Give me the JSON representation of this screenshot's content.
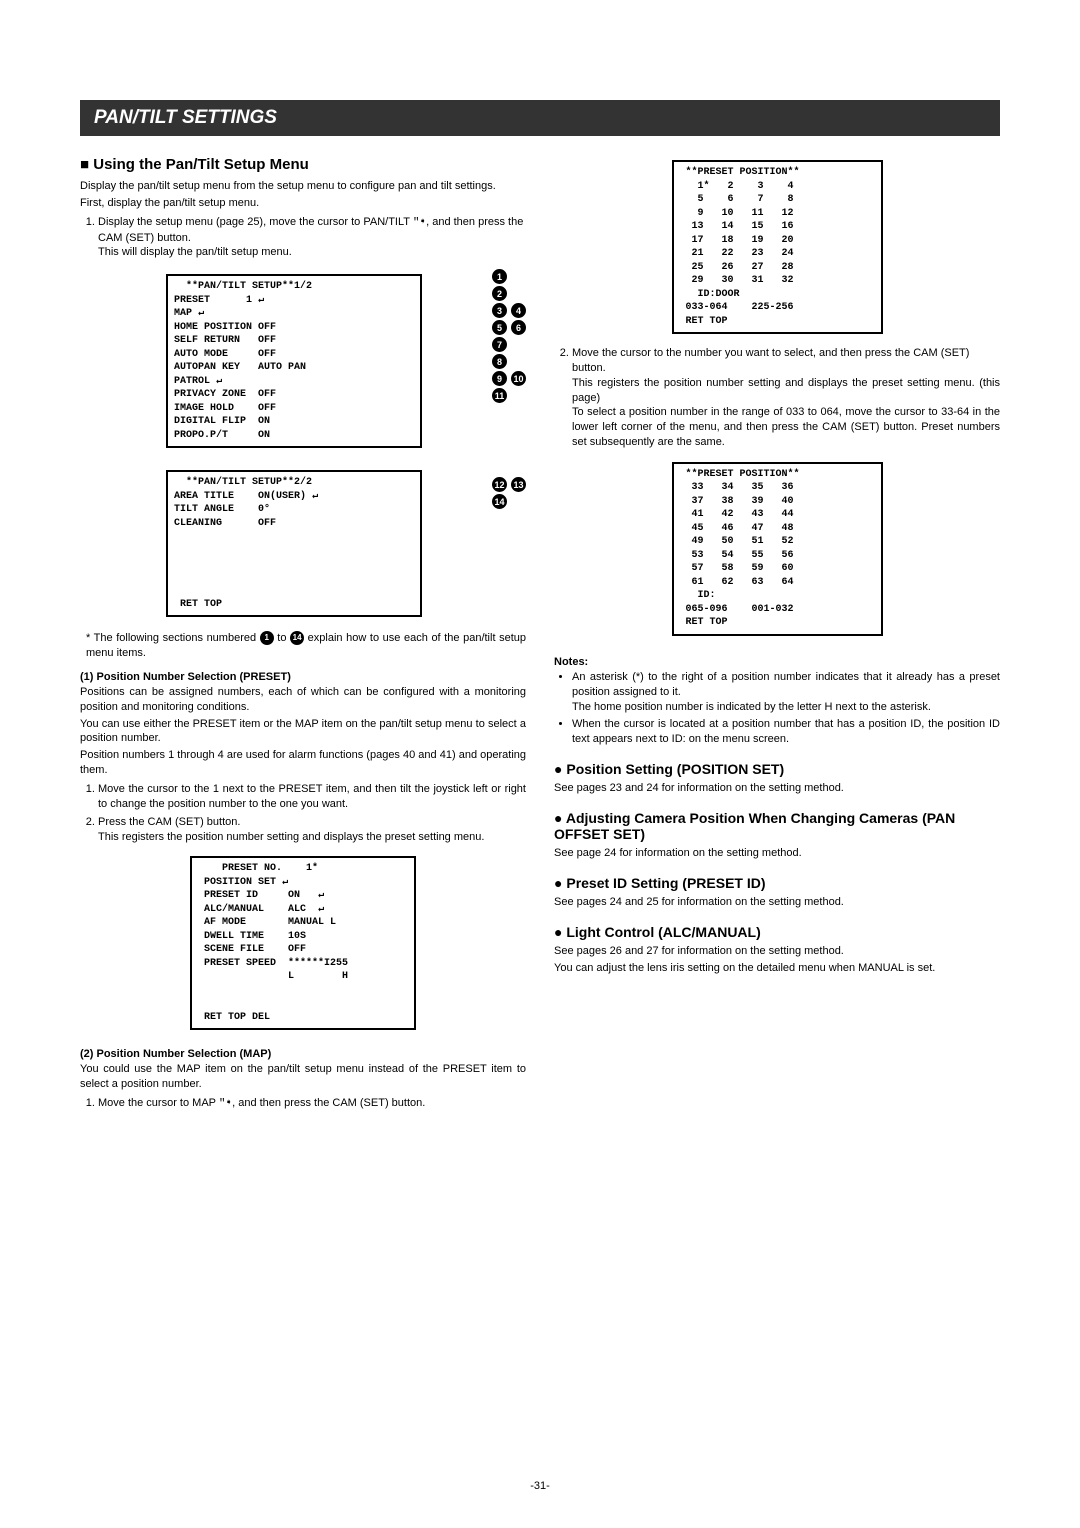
{
  "banner": "PAN/TILT SETTINGS",
  "left": {
    "h_using": "Using the Pan/Tilt Setup Menu",
    "p_intro1": "Display the pan/tilt setup menu from the setup menu to configure pan and tilt settings.",
    "p_intro2": "First, display the pan/tilt setup menu.",
    "step1a": "Display the setup menu (page 25), move the cursor to PAN/TILT ",
    "step1b": ", and then press the CAM (SET) button.",
    "step1c": "This will display the pan/tilt setup menu.",
    "screenA_lines": "  **PAN/TILT SETUP**1/2\nPRESET      1 ↵\nMAP ↵\nHOME POSITION OFF\nSELF RETURN   OFF\nAUTO MODE     OFF\nAUTOPAN KEY   AUTO PAN\nPATROL ↵\nPRIVACY ZONE  OFF\nIMAGE HOLD    OFF\nDIGITAL FLIP  ON\nPROPO.P/T     ON",
    "calloutsA": [
      "1",
      "2",
      "3",
      "4",
      "5",
      "6",
      "7",
      "8",
      "9",
      "10",
      "11"
    ],
    "screenB_lines": "  **PAN/TILT SETUP**2/2\nAREA TITLE    ON(USER) ↵\nTILT ANGLE    0°\nCLEANING      OFF\n\n\n\n\n\n RET TOP",
    "calloutsB": [
      "12",
      "13",
      "14"
    ],
    "footnote_a": "* The following sections numbered ",
    "footnote_b": " to ",
    "footnote_c": " explain how to use each of the pan/tilt setup menu items.",
    "sec1_title": "(1) Position Number Selection (PRESET)",
    "sec1_p1": "Positions can be assigned numbers, each of which can be configured with a monitoring position and monitoring conditions.",
    "sec1_p2": "You can use either the PRESET item or the MAP item on the pan/tilt setup menu to select a position number.",
    "sec1_p3": "Position numbers 1 through 4 are used for alarm functions (pages 40 and 41) and operating them.",
    "sec1_step1": "Move the cursor to the 1 next to the PRESET item, and then tilt the joystick left or right to change the position number to the one you want.",
    "sec1_step2": "Press the CAM (SET) button.",
    "sec1_step2b": "This registers the position number setting and displays the preset setting menu.",
    "screenC_lines": "    PRESET NO.    1*\n POSITION SET ↵\n PRESET ID     ON   ↵\n ALC/MANUAL    ALC  ↵\n AF MODE       MANUAL L\n DWELL TIME    10S\n SCENE FILE    OFF\n PRESET SPEED  ******I255\n               L        H\n\n\n RET TOP DEL",
    "sec2_title": "(2) Position Number Selection (MAP)",
    "sec2_p1": "You could use the MAP item on the pan/tilt setup menu instead of the PRESET item to select a position number.",
    "sec2_step1a": "Move the cursor to MAP ",
    "sec2_step1b": ", and then press the CAM (SET) button."
  },
  "right": {
    "screenD": " **PRESET POSITION**\n   1*   2    3    4\n   5    6    7    8\n   9   10   11   12\n  13   14   15   16\n  17   18   19   20\n  21   22   23   24\n  25   26   27   28\n  29   30   31   32\n   ID:DOOR\n 033-064    225-256\n RET TOP",
    "step2": "Move the cursor to the number you want to select, and then press the CAM (SET) button.",
    "step2b": "This registers the position number setting and displays the preset setting menu. (this page)",
    "step2c": "To select a position number in the range of 033 to 064, move the cursor to 33-64 in the lower left corner of the menu, and then press the CAM (SET) button. Preset numbers set subsequently are the same.",
    "screenE": " **PRESET POSITION**\n  33   34   35   36\n  37   38   39   40\n  41   42   43   44\n  45   46   47   48\n  49   50   51   52\n  53   54   55   56\n  57   58   59   60\n  61   62   63   64\n   ID:\n 065-096    001-032\n RET TOP",
    "notes_head": "Notes:",
    "note1": "An asterisk (*) to the right of a position number indicates that it already has a preset position assigned to it.",
    "note1b": "The home position number is indicated by the letter H next to the asterisk.",
    "note2": "When the cursor is located at a position number that has a position ID, the position ID text appears next to ID: on the menu screen.",
    "h_posset": "Position Setting (POSITION SET)",
    "p_posset": "See pages 23 and 24 for information on the setting method.",
    "h_adj": "Adjusting Camera Position When Changing Cameras (PAN OFFSET SET)",
    "p_adj": "See page 24 for information on the setting method.",
    "h_pid": "Preset ID Setting (PRESET ID)",
    "p_pid": "See pages 24 and 25 for information on the setting method.",
    "h_lc": "Light Control (ALC/MANUAL)",
    "p_lc": "See pages 26 and 27 for information on the setting method.",
    "p_lc2": "You can adjust the lens iris setting on the detailed menu when MANUAL is set."
  },
  "page_num": "-31-",
  "ptr_glyph": "\"➧"
}
